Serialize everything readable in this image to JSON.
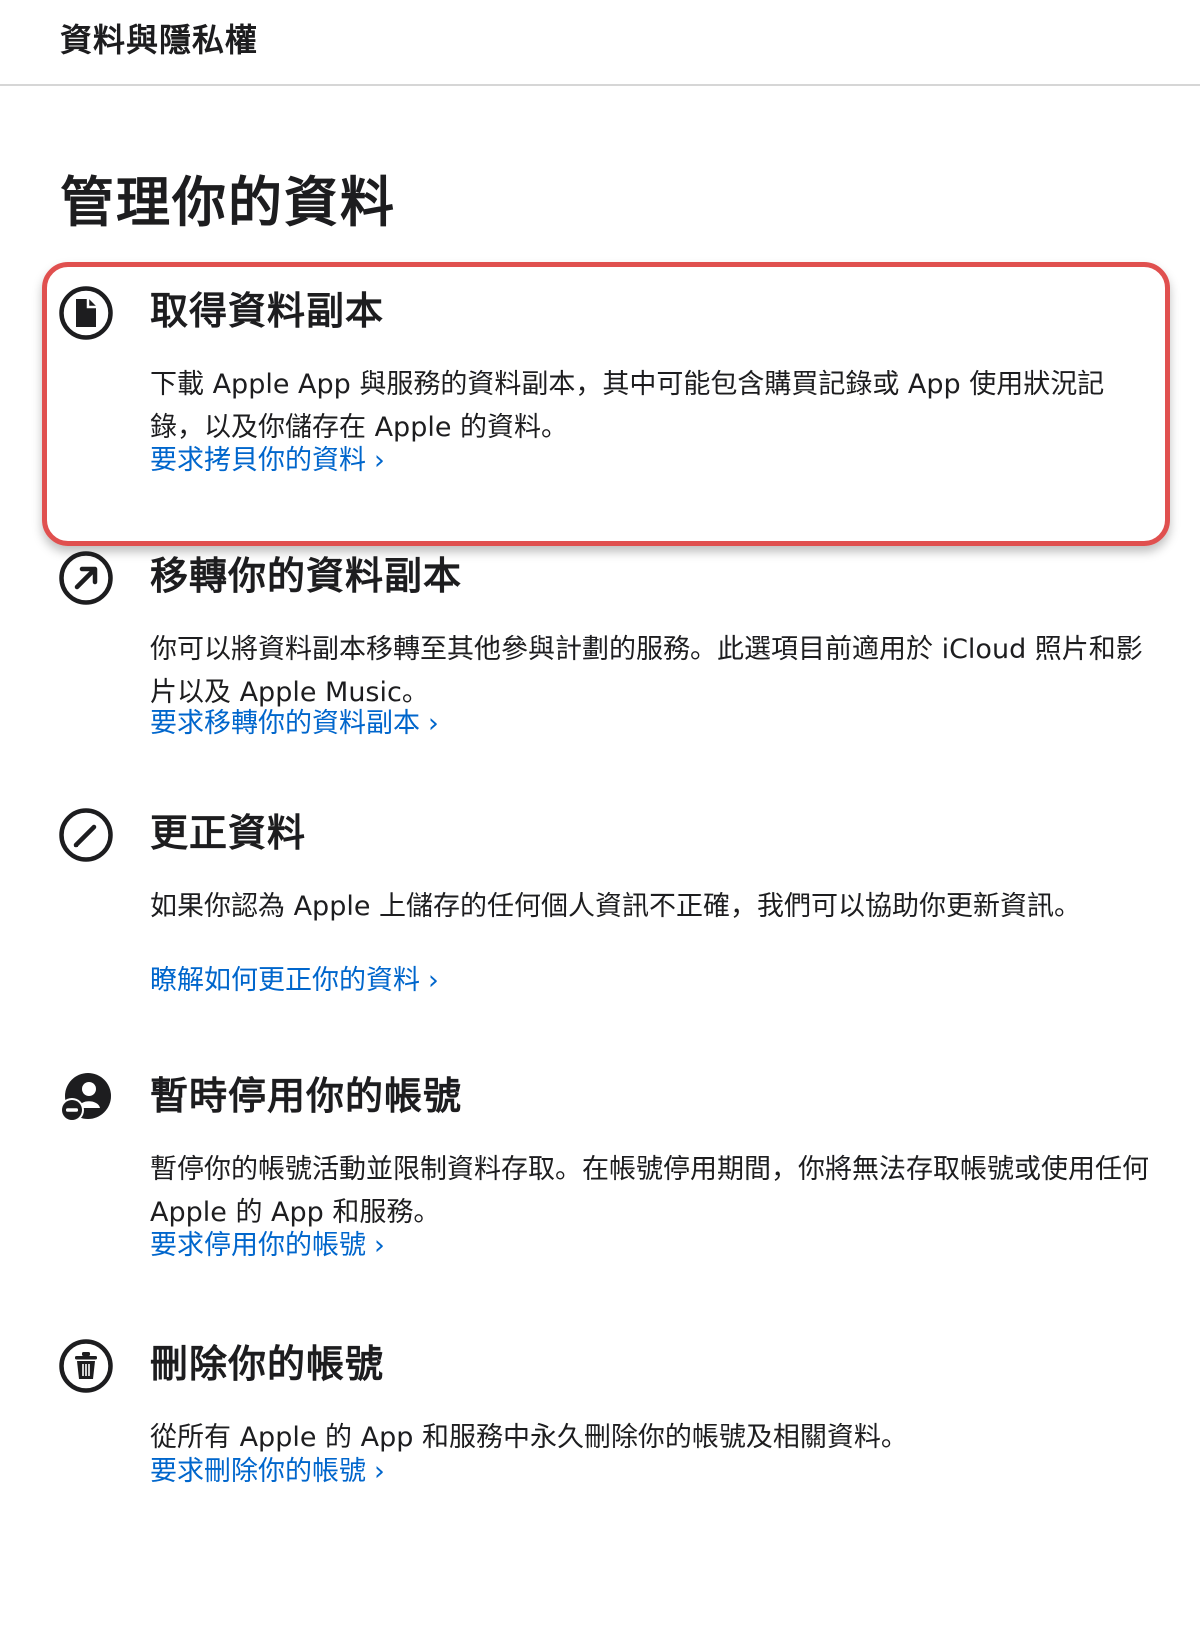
{
  "header": {
    "title": "資料與隱私權"
  },
  "main": {
    "title": "管理你的資料",
    "sections": [
      {
        "icon": "document-icon",
        "heading": "取得資料副本",
        "description": "下載 Apple App 與服務的資料副本，其中可能包含購買記錄或 App 使用狀況記錄，以及你儲存在 Apple 的資料。",
        "link": "要求拷貝你的資料",
        "chevron": "›",
        "highlighted": true
      },
      {
        "icon": "arrow-up-right-icon",
        "heading": "移轉你的資料副本",
        "description": "你可以將資料副本移轉至其他參與計劃的服務。此選項目前適用於 iCloud 照片和影片以及 Apple Music。",
        "link": "要求移轉你的資料副本",
        "chevron": "›",
        "highlighted": false
      },
      {
        "icon": "pencil-icon",
        "heading": "更正資料",
        "description": "如果你認為 Apple 上儲存的任何個人資訊不正確，我們可以協助你更新資訊。",
        "link": "瞭解如何更正你的資料",
        "chevron": "›",
        "highlighted": false
      },
      {
        "icon": "person-minus-icon",
        "heading": "暫時停用你的帳號",
        "description": "暫停你的帳號活動並限制資料存取。在帳號停用期間，你將無法存取帳號或使用任何 Apple 的 App 和服務。",
        "link": "要求停用你的帳號",
        "chevron": "›",
        "highlighted": false
      },
      {
        "icon": "trash-icon",
        "heading": "刪除你的帳號",
        "description": "從所有 Apple 的 App 和服務中永久刪除你的帳號及相關資料。",
        "link": "要求刪除你的帳號",
        "chevron": "›",
        "highlighted": false
      }
    ]
  },
  "colors": {
    "text": "#1d1d1f",
    "link": "#0066cc",
    "highlight_border": "#e0504f",
    "divider": "#d6d6d6"
  }
}
